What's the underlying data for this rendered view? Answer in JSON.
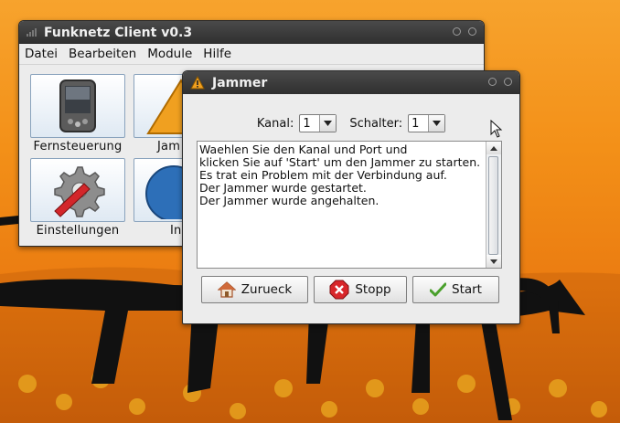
{
  "main_window": {
    "title": "Funknetz Client v0.3",
    "menu": [
      "Datei",
      "Bearbeiten",
      "Module",
      "Hilfe"
    ],
    "tiles": [
      {
        "label": "Fernsteuerung",
        "icon": "remote-device-icon"
      },
      {
        "label": "Jam",
        "icon": "warning-icon"
      },
      {
        "label": "Einstellungen",
        "icon": "settings-gear-icon"
      },
      {
        "label": "In",
        "icon": "info-icon"
      }
    ]
  },
  "jammer_dialog": {
    "title": "Jammer",
    "kanal_label": "Kanal:",
    "kanal_value": "1",
    "schalter_label": "Schalter:",
    "schalter_value": "1",
    "log_lines": [
      "Waehlen Sie den Kanal und Port und",
      "klicken Sie auf 'Start' um den Jammer zu starten.",
      "Es trat ein Problem mit der Verbindung auf.",
      "Der Jammer wurde gestartet.",
      "Der Jammer wurde angehalten."
    ],
    "buttons": {
      "back": "Zurueck",
      "stop": "Stopp",
      "start": "Start"
    }
  },
  "colors": {
    "titlebar": "#3b3b3b",
    "window_bg": "#ececec",
    "desktop": "#f39018",
    "accent_warning": "#f0a020",
    "stop_red": "#d8262a",
    "start_green": "#4aa02c"
  }
}
